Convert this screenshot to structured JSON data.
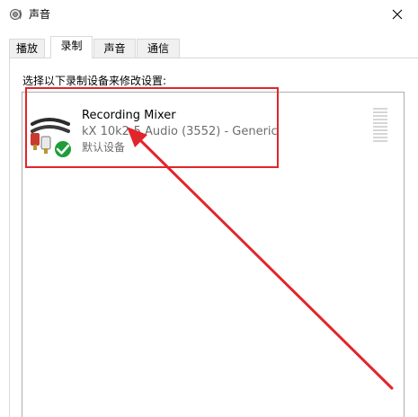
{
  "window": {
    "title": "声音",
    "icon": "speaker-icon",
    "close_icon": "close-icon"
  },
  "tabs": [
    {
      "label": "播放",
      "active": false
    },
    {
      "label": "录制",
      "active": true
    },
    {
      "label": "声音",
      "active": false
    },
    {
      "label": "通信",
      "active": false
    }
  ],
  "instruction": "选择以下录制设备来修改设置:",
  "devices": [
    {
      "name": "Recording Mixer",
      "description": "kX 10k2-5 Audio (3552) - Generic",
      "status": "默认设备",
      "icon": "audio-cable-icon",
      "badge": "green-check-icon",
      "level_meter": "level-meter"
    }
  ],
  "colors": {
    "annotation_red": "#e2252b",
    "check_green": "#1e9e3b",
    "status_text": "#6d6d6d"
  }
}
